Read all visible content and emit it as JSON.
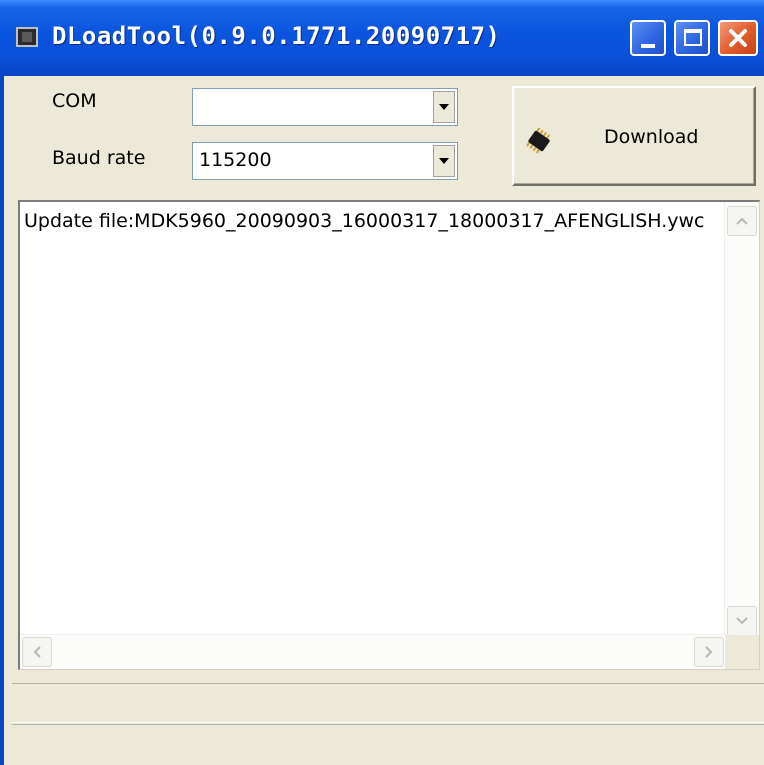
{
  "window": {
    "title": "DLoadTool(0.9.0.1771.20090717)"
  },
  "form": {
    "com_label": "COM",
    "com_value": "",
    "baud_label": "Baud rate",
    "baud_value": "115200"
  },
  "download_button": {
    "label": "Download",
    "icon": "chip-icon"
  },
  "log": {
    "lines": [
      "Update file:MDK5960_20090903_16000317_18000317_AFENGLISH.ywc"
    ]
  },
  "status_bar": {
    "panel1": "",
    "panel2": ""
  },
  "colors": {
    "titlebar": "#0A54DF",
    "face": "#ECE9D8",
    "close_button": "#E05A2A"
  }
}
